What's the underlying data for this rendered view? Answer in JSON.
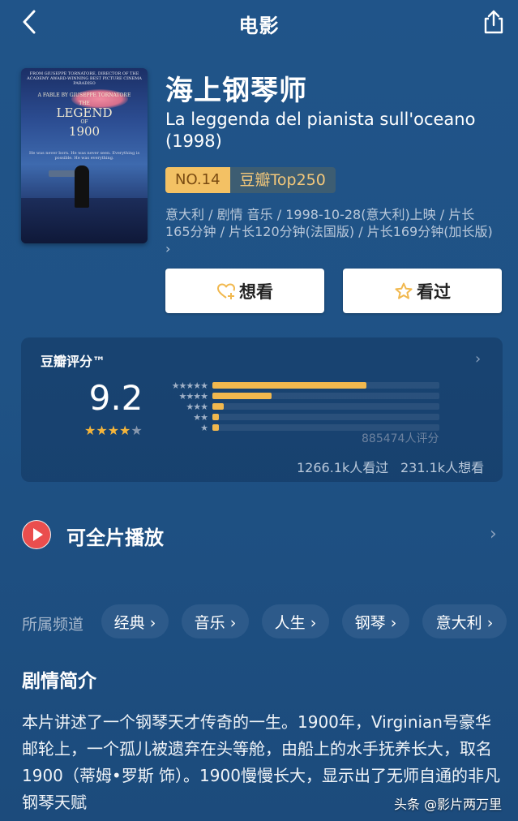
{
  "header": {
    "title": "电影",
    "back_icon": "chevron-left-icon",
    "share_icon": "share-icon"
  },
  "poster": {
    "credit": "FROM GIUSEPPE TORNATORE, DIRECTOR OF THE ACADEMY AWARD-WINNING BEST PICTURE CINEMA PARADISO",
    "fable": "A FABLE BY GIUSEPPE TORNATORE",
    "title_line1": "THE",
    "title_line2": "LEGEND",
    "title_line3": "OF",
    "title_line4": "1900",
    "tagline": "He was never born. He was never seen. Everything is possible. He was everything."
  },
  "movie": {
    "title_cn": "海上钢琴师",
    "title_orig": "La leggenda del pianista sull'oceano (1998)",
    "rank_no": "NO.14",
    "rank_list": "豆瓣Top250",
    "meta": "意大利 / 剧情 音乐 / 1998-10-28(意大利)上映 / 片长165分钟 / 片长120分钟(法国版) / 片长169分钟(加长版)",
    "meta_chevron": "›"
  },
  "actions": {
    "want": "想看",
    "seen": "看过"
  },
  "rating": {
    "label": "豆瓣评分™",
    "score": "9.2",
    "stars_full": "★★★★",
    "stars_half": "★",
    "distribution": [
      {
        "stars": "★★★★★",
        "percent": 0.68
      },
      {
        "stars": "★★★★",
        "percent": 0.26
      },
      {
        "stars": "★★★",
        "percent": 0.05
      },
      {
        "stars": "★★",
        "percent": 0.01
      },
      {
        "stars": "★",
        "percent": 0.01
      }
    ],
    "raters": "885474人评分",
    "seen_count": "1266.1k人看过",
    "want_count": "231.1k人想看"
  },
  "play": {
    "label": "可全片播放",
    "chevron": "›"
  },
  "channels": {
    "label": "所属频道",
    "items": [
      {
        "label": "经典 ›"
      },
      {
        "label": "音乐 ›"
      },
      {
        "label": "人生 ›"
      },
      {
        "label": "钢琴 ›"
      },
      {
        "label": "意大利 ›"
      }
    ]
  },
  "synopsis": {
    "title": "剧情简介",
    "text": "本片讲述了一个钢琴天才传奇的一生。1900年，Virginian号豪华邮轮上，一个孤儿被遗弃在头等舱，由船上的水手抚养长大，取名1900（蒂姆•罗斯 饰）。1900慢慢长大，显示出了无师自通的非凡钢琴天赋"
  },
  "watermark": "头条 @影片两万里",
  "colors": {
    "background": "#205489",
    "accent": "#f1b84e",
    "rank_bg": "#f3c164"
  }
}
